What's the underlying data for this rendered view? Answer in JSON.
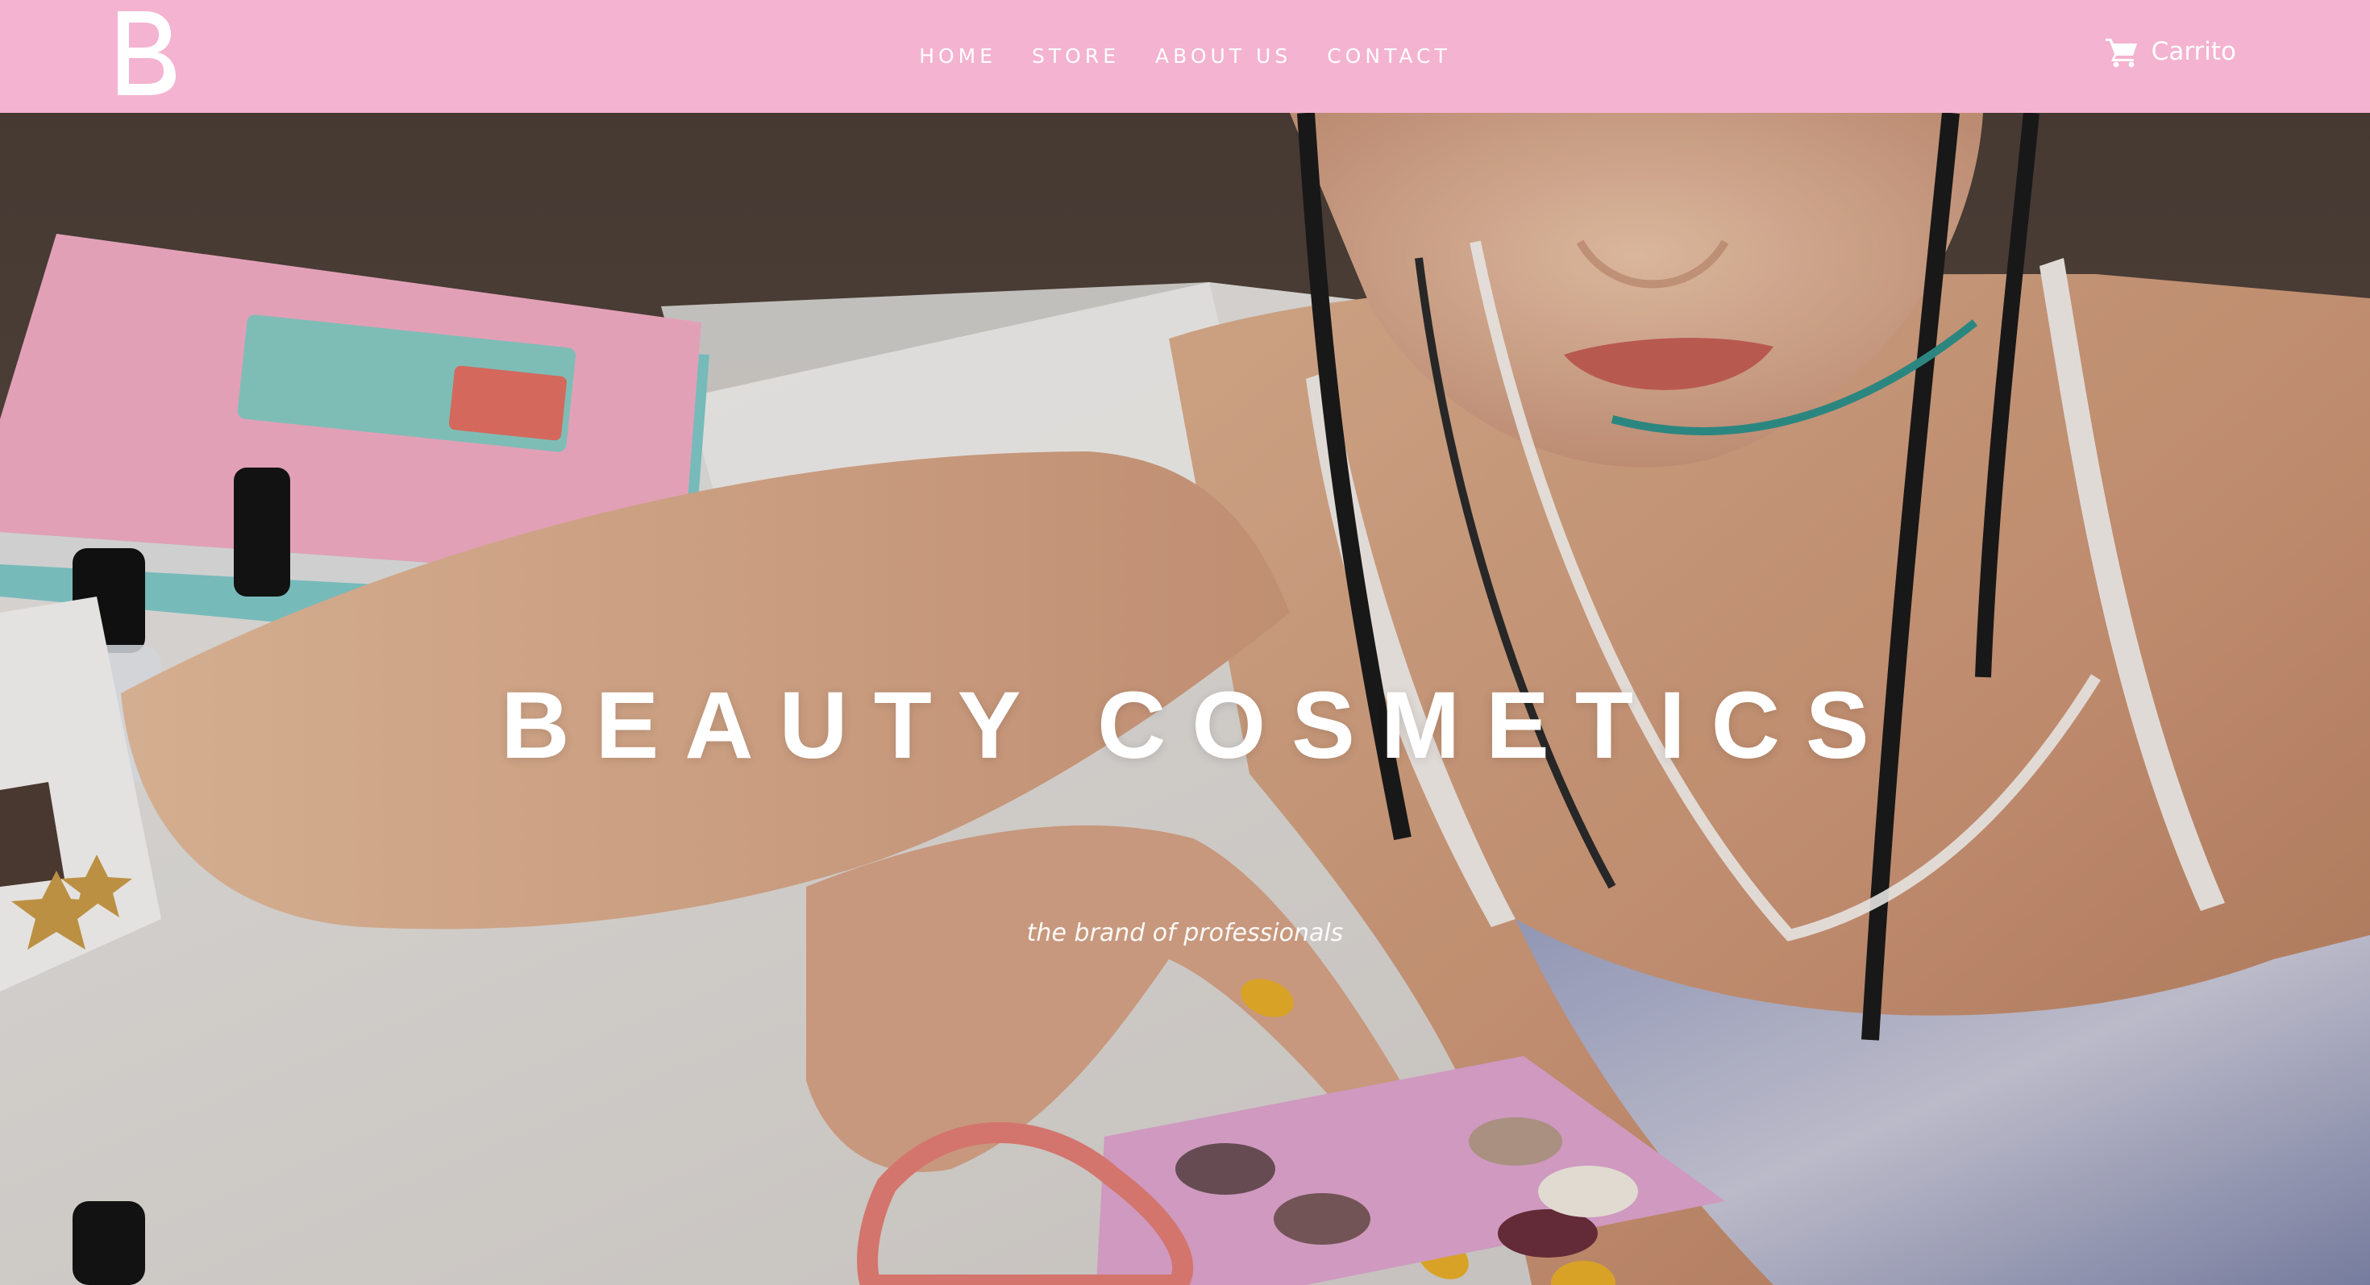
{
  "brand": {
    "logo_letter": "B",
    "header_color": "#f4b3d0"
  },
  "nav": {
    "items": [
      {
        "label": "HOME"
      },
      {
        "label": "STORE"
      },
      {
        "label": "ABOUT US"
      },
      {
        "label": "CONTACT"
      }
    ]
  },
  "cart": {
    "icon": "shopping-cart-icon",
    "label": "Carrito"
  },
  "hero": {
    "title": "BEAUTY COSMETICS",
    "subtitle": "the brand of professionals"
  }
}
